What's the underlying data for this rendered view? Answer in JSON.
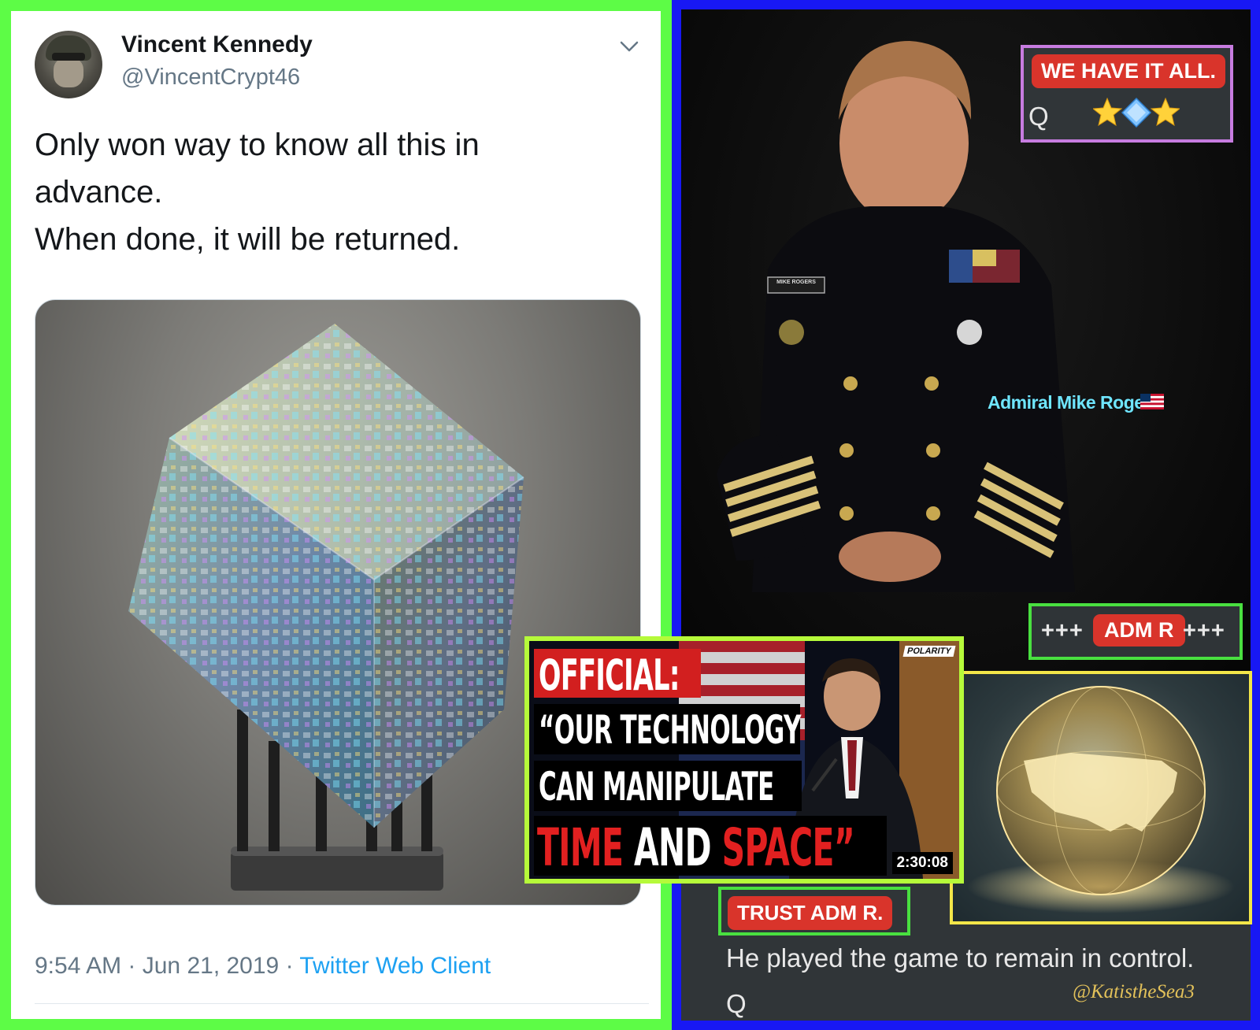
{
  "tweet": {
    "display_name": "Vincent Kennedy",
    "handle": "@VincentCrypt46",
    "lines": [
      "Only won way to know all this in",
      "advance.",
      "When done, it will be returned."
    ],
    "time": "9:54 AM",
    "separator": " · ",
    "date": "Jun 21, 2019",
    "client": "Twitter Web Client",
    "icons": [
      "avatar",
      "chevron-down-icon",
      "crystal-cube-image"
    ]
  },
  "post_panel": {
    "we_have_label": "WE HAVE IT ALL.",
    "we_have_signature": "Q",
    "caption": "Admiral Mike Rogers",
    "uniform_nametag": "MIKE ROGERS",
    "adm_prefix": "+++",
    "adm_label": "ADM R",
    "adm_suffix": "+++",
    "trust_label": "TRUST ADM R.",
    "footer_text": "He played the game to remain in control.",
    "footer_signature": "Q",
    "watermark": "@KatistheSea3",
    "icons": [
      "star-emoji-icon",
      "diamond-emoji-icon",
      "us-flag-icon",
      "glowing-globe-image"
    ]
  },
  "video_thumbnail": {
    "line1": "OFFICIAL:",
    "line2": "“OUR TECHNOLOGY",
    "line3": "CAN MANIPULATE",
    "line4_a": "TIME ",
    "line4_b": "AND ",
    "line4_c": "SPACE”",
    "duration": "2:30:08",
    "brand": "POLARITY"
  },
  "colors": {
    "left_frame": "#5dfc46",
    "right_frame": "#1818f4",
    "pill_red": "#d9342b",
    "link_blue": "#1da1f2",
    "caption_cyan": "#6fe6ff",
    "thumb_frame": "#b6fa3a",
    "globe_frame": "#f3e649",
    "label_frame_purple": "#c77ce0"
  }
}
